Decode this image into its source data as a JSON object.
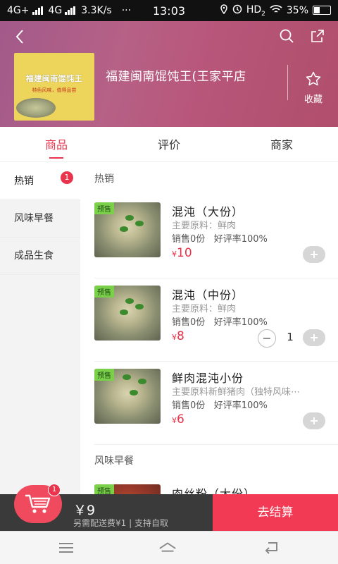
{
  "status_bar": {
    "network": "4G+",
    "network2": "4G",
    "speed": "3.3K/s",
    "dots": "···",
    "time": "13:03",
    "hd": "HD",
    "hd_sub": "2",
    "battery": "35%"
  },
  "header": {
    "logo_title": "福建闽南馄饨王",
    "logo_subtitle": "特色风味，值得品尝",
    "shop_name": "福建闽南馄饨王(王家平店",
    "favorite_label": "收藏"
  },
  "tabs": [
    {
      "label": "商品",
      "active": true
    },
    {
      "label": "评价",
      "active": false
    },
    {
      "label": "商家",
      "active": false
    }
  ],
  "sidebar": {
    "items": [
      {
        "label": "热销",
        "badge": "1"
      },
      {
        "label": "风味早餐",
        "badge": ""
      },
      {
        "label": "成品生食",
        "badge": ""
      }
    ]
  },
  "sections": [
    {
      "title": "热销",
      "items": [
        {
          "tag": "预售",
          "name": "混沌（大份）",
          "desc": "主要原料：鲜肉",
          "sales": "销售0份",
          "rating": "好评率100%",
          "currency": "¥",
          "price": "10",
          "qty": ""
        },
        {
          "tag": "预售",
          "name": "混沌（中份）",
          "desc": "主要原料：鲜肉",
          "sales": "销售0份",
          "rating": "好评率100%",
          "currency": "¥",
          "price": "8",
          "qty": "1"
        },
        {
          "tag": "预售",
          "name": "鲜肉混沌小份",
          "desc": "主要原料新鲜猪肉（独特风味⋯",
          "sales": "销售0份",
          "rating": "好评率100%",
          "currency": "¥",
          "price": "6",
          "qty": ""
        }
      ]
    },
    {
      "title": "风味早餐",
      "items": [
        {
          "tag": "预售",
          "name": "肉丝粉（大份）",
          "desc": "",
          "sales": "",
          "rating": "",
          "currency": "",
          "price": "",
          "qty": ""
        }
      ]
    }
  ],
  "cart": {
    "badge": "1",
    "total": "￥9",
    "note": "另需配送费¥1 | 支持自取",
    "checkout_label": "去结算"
  },
  "colors": {
    "accent": "#e8344c",
    "checkout": "#f23a55",
    "cart_bar": "#3a3a3a"
  }
}
